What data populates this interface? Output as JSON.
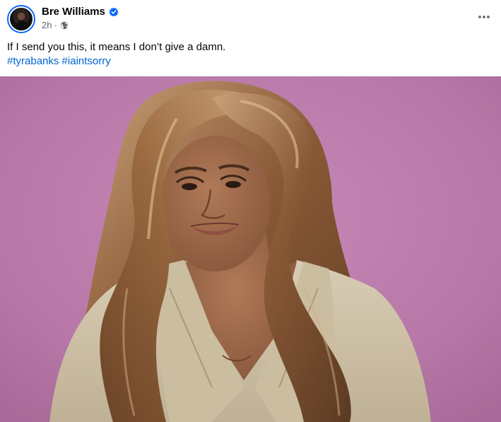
{
  "post": {
    "author": {
      "name": "Bre Williams",
      "verified_icon": "verified-badge-icon",
      "avatar_icon": "avatar"
    },
    "meta": {
      "time": "2h",
      "separator": "·",
      "audience_icon": "globe-icon"
    },
    "menu_icon": "more-horizontal-icon",
    "text": "If I send you this, it means I don’t give a damn.",
    "hashtags": [
      "#tyrabanks",
      "#iaintsorry"
    ]
  },
  "colors": {
    "link": "#0064d1",
    "verified": "#0866ff",
    "background_pink": "#b879a6",
    "secondary_text": "#65676b"
  }
}
